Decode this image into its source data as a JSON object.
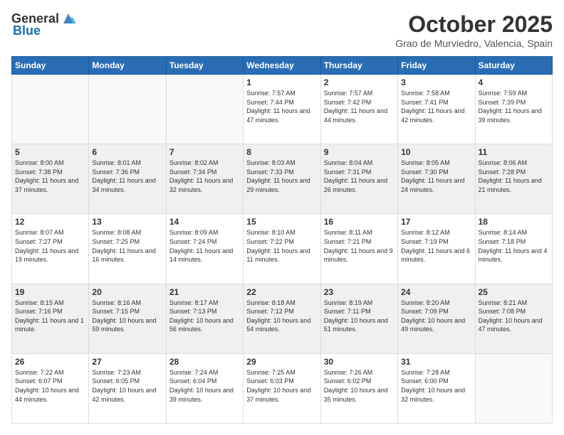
{
  "header": {
    "logo_general": "General",
    "logo_blue": "Blue",
    "month": "October 2025",
    "location": "Grao de Murviedro, Valencia, Spain"
  },
  "weekdays": [
    "Sunday",
    "Monday",
    "Tuesday",
    "Wednesday",
    "Thursday",
    "Friday",
    "Saturday"
  ],
  "weeks": [
    [
      {
        "day": "",
        "info": ""
      },
      {
        "day": "",
        "info": ""
      },
      {
        "day": "",
        "info": ""
      },
      {
        "day": "1",
        "info": "Sunrise: 7:57 AM\nSunset: 7:44 PM\nDaylight: 11 hours and 47 minutes."
      },
      {
        "day": "2",
        "info": "Sunrise: 7:57 AM\nSunset: 7:42 PM\nDaylight: 11 hours and 44 minutes."
      },
      {
        "day": "3",
        "info": "Sunrise: 7:58 AM\nSunset: 7:41 PM\nDaylight: 11 hours and 42 minutes."
      },
      {
        "day": "4",
        "info": "Sunrise: 7:59 AM\nSunset: 7:39 PM\nDaylight: 11 hours and 39 minutes."
      }
    ],
    [
      {
        "day": "5",
        "info": "Sunrise: 8:00 AM\nSunset: 7:38 PM\nDaylight: 11 hours and 37 minutes."
      },
      {
        "day": "6",
        "info": "Sunrise: 8:01 AM\nSunset: 7:36 PM\nDaylight: 11 hours and 34 minutes."
      },
      {
        "day": "7",
        "info": "Sunrise: 8:02 AM\nSunset: 7:34 PM\nDaylight: 11 hours and 32 minutes."
      },
      {
        "day": "8",
        "info": "Sunrise: 8:03 AM\nSunset: 7:33 PM\nDaylight: 11 hours and 29 minutes."
      },
      {
        "day": "9",
        "info": "Sunrise: 8:04 AM\nSunset: 7:31 PM\nDaylight: 11 hours and 26 minutes."
      },
      {
        "day": "10",
        "info": "Sunrise: 8:05 AM\nSunset: 7:30 PM\nDaylight: 11 hours and 24 minutes."
      },
      {
        "day": "11",
        "info": "Sunrise: 8:06 AM\nSunset: 7:28 PM\nDaylight: 11 hours and 21 minutes."
      }
    ],
    [
      {
        "day": "12",
        "info": "Sunrise: 8:07 AM\nSunset: 7:27 PM\nDaylight: 11 hours and 19 minutes."
      },
      {
        "day": "13",
        "info": "Sunrise: 8:08 AM\nSunset: 7:25 PM\nDaylight: 11 hours and 16 minutes."
      },
      {
        "day": "14",
        "info": "Sunrise: 8:09 AM\nSunset: 7:24 PM\nDaylight: 11 hours and 14 minutes."
      },
      {
        "day": "15",
        "info": "Sunrise: 8:10 AM\nSunset: 7:22 PM\nDaylight: 11 hours and 11 minutes."
      },
      {
        "day": "16",
        "info": "Sunrise: 8:11 AM\nSunset: 7:21 PM\nDaylight: 11 hours and 9 minutes."
      },
      {
        "day": "17",
        "info": "Sunrise: 8:12 AM\nSunset: 7:19 PM\nDaylight: 11 hours and 6 minutes."
      },
      {
        "day": "18",
        "info": "Sunrise: 8:14 AM\nSunset: 7:18 PM\nDaylight: 11 hours and 4 minutes."
      }
    ],
    [
      {
        "day": "19",
        "info": "Sunrise: 8:15 AM\nSunset: 7:16 PM\nDaylight: 11 hours and 1 minute."
      },
      {
        "day": "20",
        "info": "Sunrise: 8:16 AM\nSunset: 7:15 PM\nDaylight: 10 hours and 59 minutes."
      },
      {
        "day": "21",
        "info": "Sunrise: 8:17 AM\nSunset: 7:13 PM\nDaylight: 10 hours and 56 minutes."
      },
      {
        "day": "22",
        "info": "Sunrise: 8:18 AM\nSunset: 7:12 PM\nDaylight: 10 hours and 54 minutes."
      },
      {
        "day": "23",
        "info": "Sunrise: 8:19 AM\nSunset: 7:11 PM\nDaylight: 10 hours and 51 minutes."
      },
      {
        "day": "24",
        "info": "Sunrise: 8:20 AM\nSunset: 7:09 PM\nDaylight: 10 hours and 49 minutes."
      },
      {
        "day": "25",
        "info": "Sunrise: 8:21 AM\nSunset: 7:08 PM\nDaylight: 10 hours and 47 minutes."
      }
    ],
    [
      {
        "day": "26",
        "info": "Sunrise: 7:22 AM\nSunset: 6:07 PM\nDaylight: 10 hours and 44 minutes."
      },
      {
        "day": "27",
        "info": "Sunrise: 7:23 AM\nSunset: 6:05 PM\nDaylight: 10 hours and 42 minutes."
      },
      {
        "day": "28",
        "info": "Sunrise: 7:24 AM\nSunset: 6:04 PM\nDaylight: 10 hours and 39 minutes."
      },
      {
        "day": "29",
        "info": "Sunrise: 7:25 AM\nSunset: 6:03 PM\nDaylight: 10 hours and 37 minutes."
      },
      {
        "day": "30",
        "info": "Sunrise: 7:26 AM\nSunset: 6:02 PM\nDaylight: 10 hours and 35 minutes."
      },
      {
        "day": "31",
        "info": "Sunrise: 7:28 AM\nSunset: 6:00 PM\nDaylight: 10 hours and 32 minutes."
      },
      {
        "day": "",
        "info": ""
      }
    ]
  ]
}
